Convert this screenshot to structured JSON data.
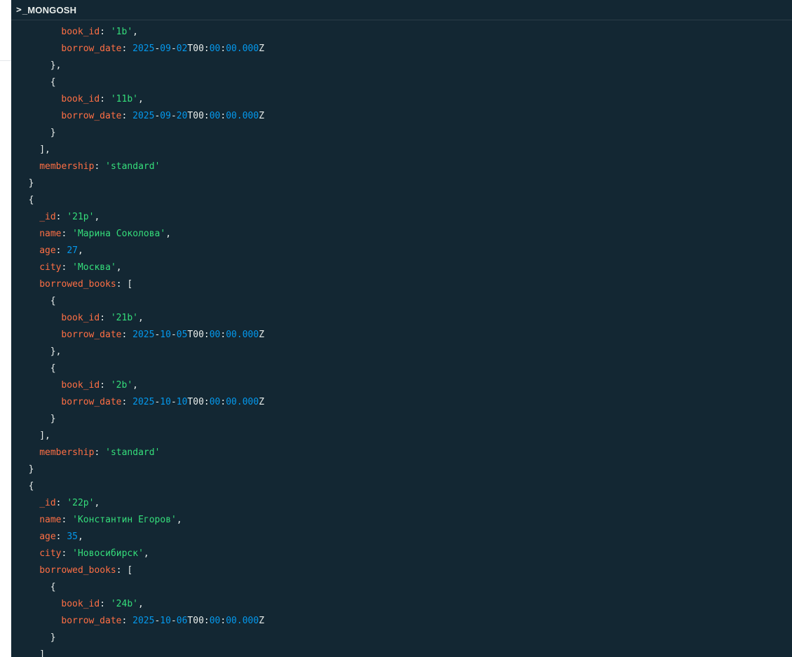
{
  "window": {
    "prompt_symbol": ">",
    "title": "_MONGOSH"
  },
  "colors": {
    "background": "#132733",
    "key": "#ff6f44",
    "string": "#35de7b",
    "number": "#0498ec",
    "punctuation": "#e8edeb"
  },
  "lines": [
    {
      "indent": 4,
      "tokens": [
        {
          "t": "k",
          "v": "book_id"
        },
        {
          "t": "p",
          "v": ": "
        },
        {
          "t": "s",
          "v": "'1b'"
        },
        {
          "t": "p",
          "v": ","
        }
      ]
    },
    {
      "indent": 4,
      "tokens": [
        {
          "t": "k",
          "v": "borrow_date"
        },
        {
          "t": "p",
          "v": ": "
        },
        {
          "t": "n",
          "v": "2025"
        },
        {
          "t": "p",
          "v": "-"
        },
        {
          "t": "n",
          "v": "09"
        },
        {
          "t": "p",
          "v": "-"
        },
        {
          "t": "n",
          "v": "02"
        },
        {
          "t": "p",
          "v": "T"
        },
        {
          "t": "p",
          "v": "00"
        },
        {
          "t": "p",
          "v": ":"
        },
        {
          "t": "n",
          "v": "00"
        },
        {
          "t": "p",
          "v": ":"
        },
        {
          "t": "n",
          "v": "00.000"
        },
        {
          "t": "p",
          "v": "Z"
        }
      ]
    },
    {
      "indent": 3,
      "tokens": [
        {
          "t": "p",
          "v": "},"
        }
      ]
    },
    {
      "indent": 3,
      "tokens": [
        {
          "t": "p",
          "v": "{"
        }
      ]
    },
    {
      "indent": 4,
      "tokens": [
        {
          "t": "k",
          "v": "book_id"
        },
        {
          "t": "p",
          "v": ": "
        },
        {
          "t": "s",
          "v": "'11b'"
        },
        {
          "t": "p",
          "v": ","
        }
      ]
    },
    {
      "indent": 4,
      "tokens": [
        {
          "t": "k",
          "v": "borrow_date"
        },
        {
          "t": "p",
          "v": ": "
        },
        {
          "t": "n",
          "v": "2025"
        },
        {
          "t": "p",
          "v": "-"
        },
        {
          "t": "n",
          "v": "09"
        },
        {
          "t": "p",
          "v": "-"
        },
        {
          "t": "n",
          "v": "20"
        },
        {
          "t": "p",
          "v": "T"
        },
        {
          "t": "p",
          "v": "00"
        },
        {
          "t": "p",
          "v": ":"
        },
        {
          "t": "n",
          "v": "00"
        },
        {
          "t": "p",
          "v": ":"
        },
        {
          "t": "n",
          "v": "00.000"
        },
        {
          "t": "p",
          "v": "Z"
        }
      ]
    },
    {
      "indent": 3,
      "tokens": [
        {
          "t": "p",
          "v": "}"
        }
      ]
    },
    {
      "indent": 2,
      "tokens": [
        {
          "t": "p",
          "v": "],"
        }
      ]
    },
    {
      "indent": 2,
      "tokens": [
        {
          "t": "k",
          "v": "membership"
        },
        {
          "t": "p",
          "v": ": "
        },
        {
          "t": "s",
          "v": "'standard'"
        }
      ]
    },
    {
      "indent": 1,
      "tokens": [
        {
          "t": "p",
          "v": "}"
        }
      ]
    },
    {
      "indent": 1,
      "tokens": [
        {
          "t": "p",
          "v": "{"
        }
      ]
    },
    {
      "indent": 2,
      "tokens": [
        {
          "t": "k",
          "v": "_id"
        },
        {
          "t": "p",
          "v": ": "
        },
        {
          "t": "s",
          "v": "'21p'"
        },
        {
          "t": "p",
          "v": ","
        }
      ]
    },
    {
      "indent": 2,
      "tokens": [
        {
          "t": "k",
          "v": "name"
        },
        {
          "t": "p",
          "v": ": "
        },
        {
          "t": "s",
          "v": "'Марина Соколова'"
        },
        {
          "t": "p",
          "v": ","
        }
      ]
    },
    {
      "indent": 2,
      "tokens": [
        {
          "t": "k",
          "v": "age"
        },
        {
          "t": "p",
          "v": ": "
        },
        {
          "t": "n",
          "v": "27"
        },
        {
          "t": "p",
          "v": ","
        }
      ]
    },
    {
      "indent": 2,
      "tokens": [
        {
          "t": "k",
          "v": "city"
        },
        {
          "t": "p",
          "v": ": "
        },
        {
          "t": "s",
          "v": "'Москва'"
        },
        {
          "t": "p",
          "v": ","
        }
      ]
    },
    {
      "indent": 2,
      "tokens": [
        {
          "t": "k",
          "v": "borrowed_books"
        },
        {
          "t": "p",
          "v": ": ["
        }
      ]
    },
    {
      "indent": 3,
      "tokens": [
        {
          "t": "p",
          "v": "{"
        }
      ]
    },
    {
      "indent": 4,
      "tokens": [
        {
          "t": "k",
          "v": "book_id"
        },
        {
          "t": "p",
          "v": ": "
        },
        {
          "t": "s",
          "v": "'21b'"
        },
        {
          "t": "p",
          "v": ","
        }
      ]
    },
    {
      "indent": 4,
      "tokens": [
        {
          "t": "k",
          "v": "borrow_date"
        },
        {
          "t": "p",
          "v": ": "
        },
        {
          "t": "n",
          "v": "2025"
        },
        {
          "t": "p",
          "v": "-"
        },
        {
          "t": "n",
          "v": "10"
        },
        {
          "t": "p",
          "v": "-"
        },
        {
          "t": "n",
          "v": "05"
        },
        {
          "t": "p",
          "v": "T"
        },
        {
          "t": "p",
          "v": "00"
        },
        {
          "t": "p",
          "v": ":"
        },
        {
          "t": "n",
          "v": "00"
        },
        {
          "t": "p",
          "v": ":"
        },
        {
          "t": "n",
          "v": "00.000"
        },
        {
          "t": "p",
          "v": "Z"
        }
      ]
    },
    {
      "indent": 3,
      "tokens": [
        {
          "t": "p",
          "v": "},"
        }
      ]
    },
    {
      "indent": 3,
      "tokens": [
        {
          "t": "p",
          "v": "{"
        }
      ]
    },
    {
      "indent": 4,
      "tokens": [
        {
          "t": "k",
          "v": "book_id"
        },
        {
          "t": "p",
          "v": ": "
        },
        {
          "t": "s",
          "v": "'2b'"
        },
        {
          "t": "p",
          "v": ","
        }
      ]
    },
    {
      "indent": 4,
      "tokens": [
        {
          "t": "k",
          "v": "borrow_date"
        },
        {
          "t": "p",
          "v": ": "
        },
        {
          "t": "n",
          "v": "2025"
        },
        {
          "t": "p",
          "v": "-"
        },
        {
          "t": "n",
          "v": "10"
        },
        {
          "t": "p",
          "v": "-"
        },
        {
          "t": "n",
          "v": "10"
        },
        {
          "t": "p",
          "v": "T"
        },
        {
          "t": "p",
          "v": "00"
        },
        {
          "t": "p",
          "v": ":"
        },
        {
          "t": "n",
          "v": "00"
        },
        {
          "t": "p",
          "v": ":"
        },
        {
          "t": "n",
          "v": "00.000"
        },
        {
          "t": "p",
          "v": "Z"
        }
      ]
    },
    {
      "indent": 3,
      "tokens": [
        {
          "t": "p",
          "v": "}"
        }
      ]
    },
    {
      "indent": 2,
      "tokens": [
        {
          "t": "p",
          "v": "],"
        }
      ]
    },
    {
      "indent": 2,
      "tokens": [
        {
          "t": "k",
          "v": "membership"
        },
        {
          "t": "p",
          "v": ": "
        },
        {
          "t": "s",
          "v": "'standard'"
        }
      ]
    },
    {
      "indent": 1,
      "tokens": [
        {
          "t": "p",
          "v": "}"
        }
      ]
    },
    {
      "indent": 1,
      "tokens": [
        {
          "t": "p",
          "v": "{"
        }
      ]
    },
    {
      "indent": 2,
      "tokens": [
        {
          "t": "k",
          "v": "_id"
        },
        {
          "t": "p",
          "v": ": "
        },
        {
          "t": "s",
          "v": "'22p'"
        },
        {
          "t": "p",
          "v": ","
        }
      ]
    },
    {
      "indent": 2,
      "tokens": [
        {
          "t": "k",
          "v": "name"
        },
        {
          "t": "p",
          "v": ": "
        },
        {
          "t": "s",
          "v": "'Константин Егоров'"
        },
        {
          "t": "p",
          "v": ","
        }
      ]
    },
    {
      "indent": 2,
      "tokens": [
        {
          "t": "k",
          "v": "age"
        },
        {
          "t": "p",
          "v": ": "
        },
        {
          "t": "n",
          "v": "35"
        },
        {
          "t": "p",
          "v": ","
        }
      ]
    },
    {
      "indent": 2,
      "tokens": [
        {
          "t": "k",
          "v": "city"
        },
        {
          "t": "p",
          "v": ": "
        },
        {
          "t": "s",
          "v": "'Новосибирск'"
        },
        {
          "t": "p",
          "v": ","
        }
      ]
    },
    {
      "indent": 2,
      "tokens": [
        {
          "t": "k",
          "v": "borrowed_books"
        },
        {
          "t": "p",
          "v": ": ["
        }
      ]
    },
    {
      "indent": 3,
      "tokens": [
        {
          "t": "p",
          "v": "{"
        }
      ]
    },
    {
      "indent": 4,
      "tokens": [
        {
          "t": "k",
          "v": "book_id"
        },
        {
          "t": "p",
          "v": ": "
        },
        {
          "t": "s",
          "v": "'24b'"
        },
        {
          "t": "p",
          "v": ","
        }
      ]
    },
    {
      "indent": 4,
      "tokens": [
        {
          "t": "k",
          "v": "borrow_date"
        },
        {
          "t": "p",
          "v": ": "
        },
        {
          "t": "n",
          "v": "2025"
        },
        {
          "t": "p",
          "v": "-"
        },
        {
          "t": "n",
          "v": "10"
        },
        {
          "t": "p",
          "v": "-"
        },
        {
          "t": "n",
          "v": "06"
        },
        {
          "t": "p",
          "v": "T"
        },
        {
          "t": "p",
          "v": "00"
        },
        {
          "t": "p",
          "v": ":"
        },
        {
          "t": "n",
          "v": "00"
        },
        {
          "t": "p",
          "v": ":"
        },
        {
          "t": "n",
          "v": "00.000"
        },
        {
          "t": "p",
          "v": "Z"
        }
      ]
    },
    {
      "indent": 3,
      "tokens": [
        {
          "t": "p",
          "v": "}"
        }
      ]
    },
    {
      "indent": 2,
      "tokens": [
        {
          "t": "p",
          "v": "]"
        }
      ]
    }
  ]
}
